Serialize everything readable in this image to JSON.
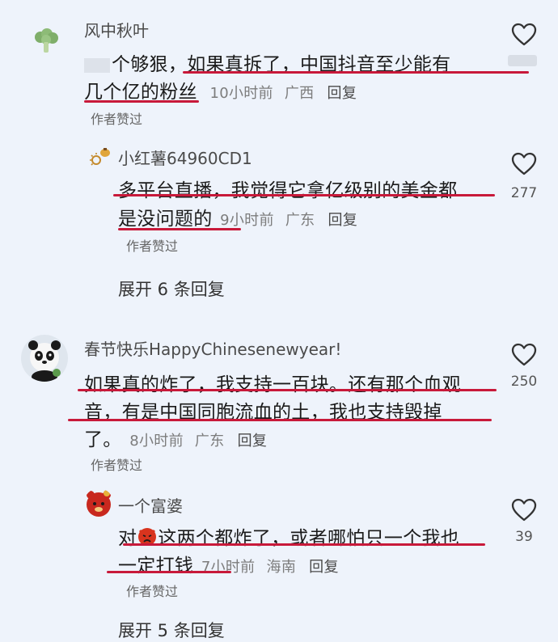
{
  "comments": [
    {
      "username": "风中秋叶",
      "lines": [
        "个够狠，如果真拆了，中国抖音至少能有",
        "几个亿的粉丝"
      ],
      "time": "10小时前",
      "location": "广西",
      "reply_label": "回复",
      "author_liked": "作者赞过",
      "like_count": "",
      "avatar_icon": "broccoli-icon"
    },
    {
      "username": "小红薯64960CD1",
      "lines": [
        "多平台直播，我觉得它拿亿级别的美金都",
        "是没问题的"
      ],
      "time": "9小时前",
      "location": "广东",
      "reply_label": "回复",
      "author_liked": "作者赞过",
      "like_count": "277",
      "avatar_icon": "sun-food-icon"
    },
    {
      "username": "春节快乐HappyChinesenewyear!",
      "lines": [
        "如果真的炸了，我支持一百块。还有那个血观",
        "音，有是中国同胞流血的土，我也支持毁掉",
        "了。"
      ],
      "time": "8小时前",
      "location": "广东",
      "reply_label": "回复",
      "author_liked": "作者赞过",
      "like_count": "250",
      "avatar_icon": "panda-icon"
    },
    {
      "username": "一个富婆",
      "lines": [
        "对",
        "这两个都炸了，或者哪怕只一个我也",
        "一定打钱"
      ],
      "time": "7小时前",
      "location": "海南",
      "reply_label": "回复",
      "author_liked": "作者赞过",
      "like_count": "39",
      "avatar_icon": "red-bear-icon",
      "inline_emoji": "angry-face-icon"
    }
  ],
  "expand_labels": [
    "展开 6 条回复",
    "展开 5 条回复"
  ],
  "colors": {
    "background": "#eef3fb",
    "underline": "#c8193a"
  }
}
